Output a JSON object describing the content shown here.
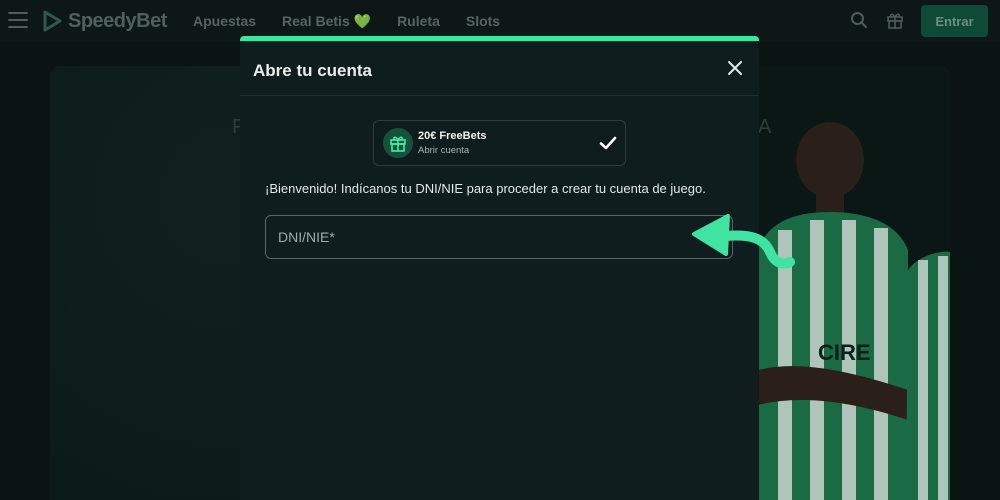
{
  "topbar": {
    "logo_text": "SpeedyBet",
    "nav_items": [
      "Apuestas",
      "Real Betis",
      "Ruleta",
      "Slots"
    ],
    "nav_heart": "💚",
    "enter_label": "Entrar",
    "icons": [
      "menu-icon",
      "search-icon",
      "gift-icon"
    ]
  },
  "hero": {
    "ghost_left": "F",
    "ghost_right": "A"
  },
  "modal": {
    "title": "Abre tu cuenta",
    "promo": {
      "title": "20€ FreeBets",
      "subtitle": "Abrir cuenta",
      "icon": "gift-icon",
      "status_icon": "check-icon"
    },
    "welcome_text": "¡Bienvenido! Indícanos tu DNI/NIE para proceder a crear tu cuenta de juego.",
    "dni_placeholder": "DNI/NIE*",
    "dni_value": ""
  },
  "colors": {
    "accent": "#38e8a0",
    "modal_bg": "#0f1d1f",
    "page_bg": "#0a1413"
  }
}
